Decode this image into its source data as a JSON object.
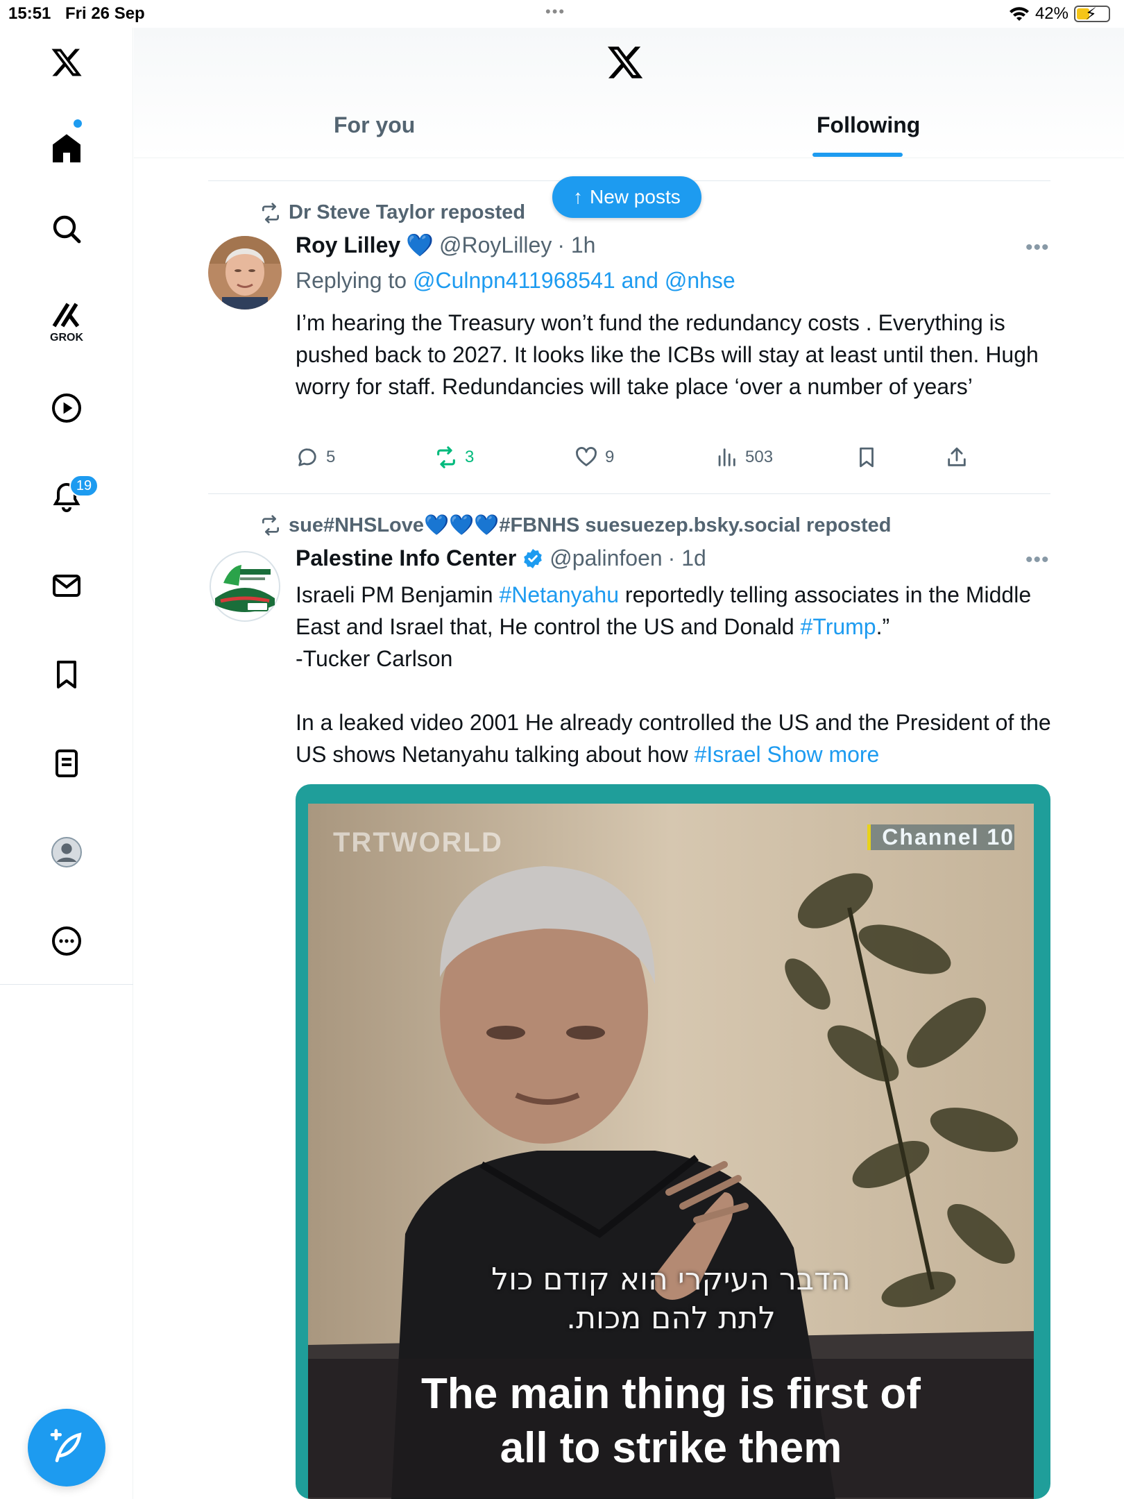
{
  "status_bar": {
    "time": "15:51",
    "date": "Fri 26 Sep",
    "battery": "42%",
    "battery_level": 0.42
  },
  "sidebar": {
    "grok_label": "GROK",
    "notifications_count": "19"
  },
  "header": {
    "tabs": [
      {
        "label": "For you"
      },
      {
        "label": "Following"
      }
    ]
  },
  "new_posts_label": "New posts",
  "posts": [
    {
      "reposted_by": "Dr Steve Taylor reposted",
      "name": "Roy Lilley",
      "emoji": "💙",
      "handle": "@RoyLilley",
      "time": "· 1h",
      "replying_prefix": "Replying to",
      "replying_handles": "@Culnpn411968541 and @nhse",
      "text": "I’m hearing the Treasury won’t fund the redundancy costs . Everything is pushed back to 2027.  It looks like the ICBs will stay at least until then. Hugh worry for staff. Redundancies will take place ‘over a number of years’",
      "replies": "5",
      "reposts": "3",
      "likes": "9",
      "views": "503"
    },
    {
      "reposted_by": "sue#NHSLove💙💙💙#FBNHS suesuezep.bsky.social reposted",
      "name": "Palestine Info Center",
      "handle": "@palinfoen",
      "time": "· 1d",
      "text_1": "Israeli PM Benjamin ",
      "tag_1": "#Netanyahu",
      "text_2": " reportedly telling associates in the Middle East and Israel that, He control the US and Donald ",
      "tag_2": "#Trump",
      "text_3": ".”",
      "text_4": "-Tucker Carlson",
      "text_5": " In a leaked video 2001 He already controlled the US and the President of the US  shows Netanyahu talking about how ",
      "tag_3": "#Israel",
      "show_more": "Show more",
      "media": {
        "brand": "TRTWORLD",
        "channel": "Channel 10",
        "subtitle_he_1": "הדבר העיקרי הוא קודם כול",
        "subtitle_he_2": "לתת להם מכות.",
        "subtitle_en_1": "The main thing is first of",
        "subtitle_en_2": "all to strike them"
      }
    }
  ],
  "colors": {
    "accent": "#1d9bf0",
    "repost_green": "#00ba7c",
    "text": "#0f1419",
    "muted": "#536471"
  }
}
